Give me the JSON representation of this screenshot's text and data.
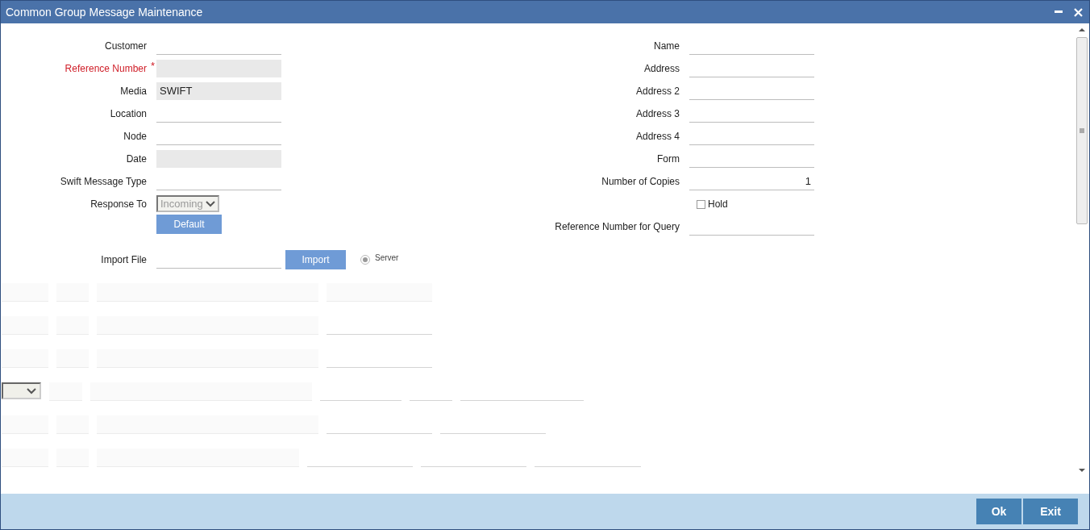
{
  "window": {
    "title": "Common Group Message Maintenance"
  },
  "left_fields": [
    {
      "kind": "text",
      "label": "Customer",
      "disabled": false,
      "required": false
    },
    {
      "kind": "text",
      "label": "Reference Number",
      "disabled": true,
      "required": true,
      "required_mark": "*"
    },
    {
      "kind": "text",
      "label": "Media",
      "value": "SWIFT",
      "disabled": true,
      "required": false
    },
    {
      "kind": "text",
      "label": "Location",
      "disabled": false,
      "required": false
    },
    {
      "kind": "text",
      "label": "Node",
      "disabled": false,
      "required": false
    },
    {
      "kind": "text",
      "label": "Date",
      "disabled": true,
      "required": false
    },
    {
      "kind": "text",
      "label": "Swift Message Type",
      "disabled": false,
      "required": false
    },
    {
      "kind": "select",
      "label": "Response To",
      "value": "Incoming",
      "disabled": true,
      "required": false
    }
  ],
  "default_button": {
    "label": "Default",
    "disabled": true
  },
  "import": {
    "label": "Import File",
    "button": "Import",
    "button_disabled": true,
    "radio": {
      "label": "Server",
      "selected": true
    }
  },
  "right_fields": [
    {
      "kind": "text",
      "label": "Name"
    },
    {
      "kind": "text",
      "label": "Address"
    },
    {
      "kind": "text",
      "label": "Address 2"
    },
    {
      "kind": "text",
      "label": "Address 3"
    },
    {
      "kind": "text",
      "label": "Address 4"
    },
    {
      "kind": "text",
      "label": "Form"
    },
    {
      "kind": "number",
      "label": "Number of Copies",
      "value": "1"
    },
    {
      "kind": "checkbox",
      "label": "Hold",
      "checked": false
    },
    {
      "kind": "text",
      "label": "Reference Number for Query"
    }
  ],
  "grid_rows": [
    {
      "cells": [
        {
          "kind": "shaded"
        },
        {
          "kind": "shaded"
        },
        {
          "kind": "shaded"
        },
        {
          "kind": "shaded"
        }
      ]
    },
    {
      "cells": [
        {
          "kind": "shaded"
        },
        {
          "kind": "shaded"
        },
        {
          "kind": "shaded"
        },
        {
          "kind": "line"
        }
      ]
    },
    {
      "cells": [
        {
          "kind": "shaded"
        },
        {
          "kind": "shaded"
        },
        {
          "kind": "shaded"
        },
        {
          "kind": "line"
        }
      ]
    },
    {
      "cells": [
        {
          "kind": "select"
        },
        {
          "kind": "shaded"
        },
        {
          "kind": "shaded"
        },
        {
          "kind": "line"
        },
        {
          "kind": "line"
        },
        {
          "kind": "line"
        }
      ]
    },
    {
      "cells": [
        {
          "kind": "shaded"
        },
        {
          "kind": "shaded"
        },
        {
          "kind": "shaded"
        },
        {
          "kind": "line"
        },
        {
          "kind": "line"
        }
      ]
    },
    {
      "cells": [
        {
          "kind": "shaded"
        },
        {
          "kind": "shaded"
        },
        {
          "kind": "shaded"
        },
        {
          "kind": "line"
        },
        {
          "kind": "line"
        },
        {
          "kind": "line"
        }
      ]
    }
  ],
  "footer_buttons": [
    {
      "label": "Ok"
    },
    {
      "label": "Exit"
    }
  ]
}
